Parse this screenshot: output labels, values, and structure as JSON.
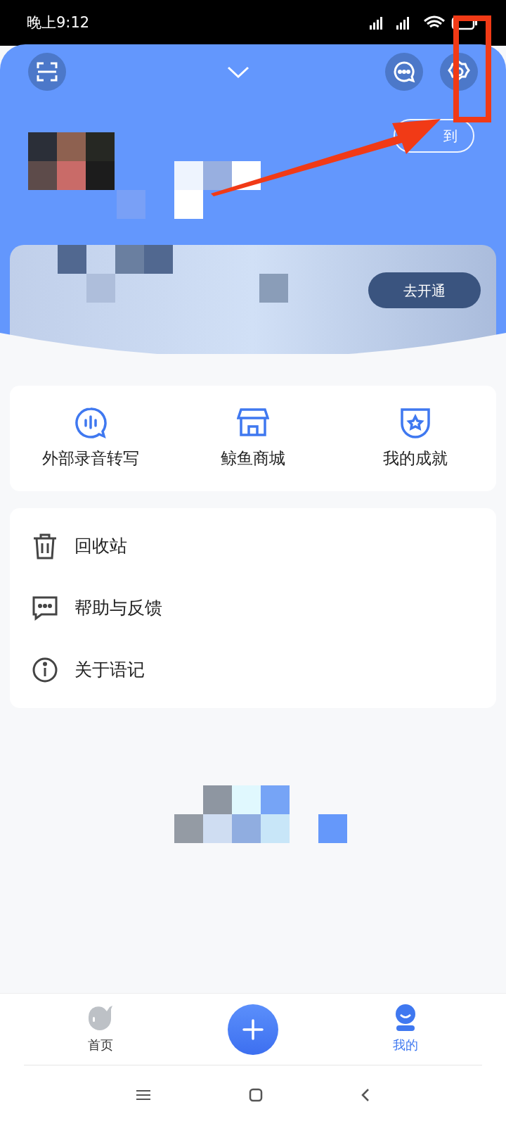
{
  "status_bar": {
    "time": "晚上9:12"
  },
  "header": {
    "checkin_button": "到",
    "membership_button": "去开通"
  },
  "shortcuts": [
    {
      "label": "外部录音转写",
      "kind": "transcribe"
    },
    {
      "label": "鲸鱼商城",
      "kind": "store"
    },
    {
      "label": "我的成就",
      "kind": "badge"
    }
  ],
  "menu": [
    {
      "label": "回收站",
      "kind": "trash"
    },
    {
      "label": "帮助与反馈",
      "kind": "feedback"
    },
    {
      "label": "关于语记",
      "kind": "info"
    }
  ],
  "bottom_nav": [
    {
      "label": "首页",
      "kind": "home",
      "selected": false
    },
    {
      "kind": "add"
    },
    {
      "label": "我的",
      "kind": "me",
      "selected": true
    }
  ]
}
